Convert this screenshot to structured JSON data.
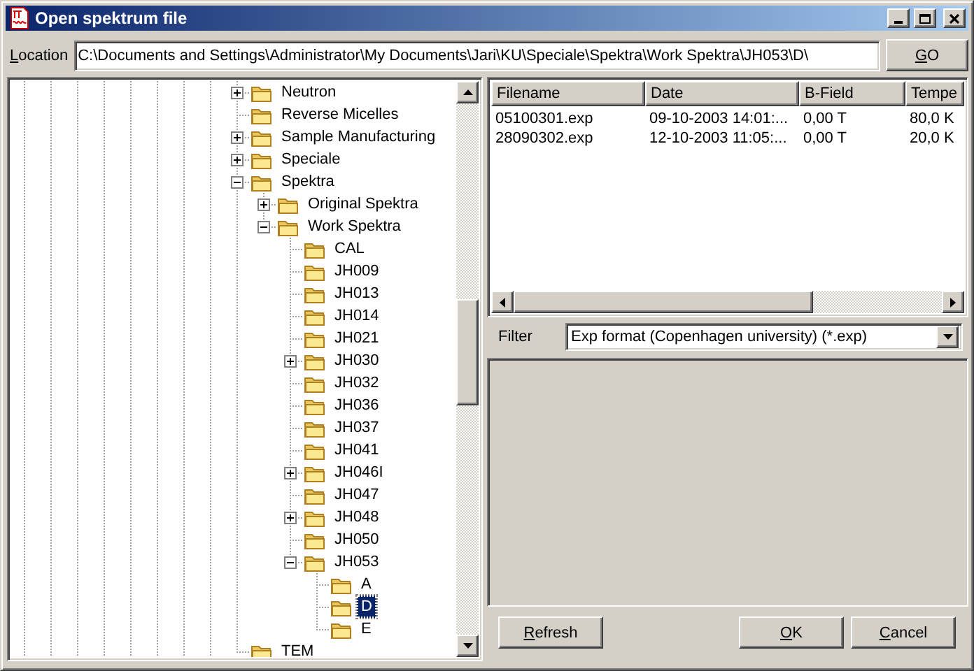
{
  "window": {
    "title": "Open spektrum file"
  },
  "location": {
    "label": "Location",
    "value": "C:\\Documents and Settings\\Administrator\\My Documents\\Jari\\KU\\Speciale\\Spektra\\Work Spektra\\JH053\\D\\"
  },
  "go_button": "GO",
  "tree": [
    {
      "label": "Neutron",
      "expanded": false,
      "selected": false
    },
    {
      "label": "Reverse Micelles",
      "selected": false
    },
    {
      "label": "Sample Manufacturing",
      "expanded": false,
      "selected": false
    },
    {
      "label": "Speciale",
      "expanded": false,
      "selected": false
    },
    {
      "label": "Spektra",
      "expanded": true,
      "selected": false,
      "children": [
        {
          "label": "Original Spektra",
          "expanded": false,
          "selected": false
        },
        {
          "label": "Work Spektra",
          "expanded": true,
          "selected": false,
          "children": [
            {
              "label": "CAL",
              "selected": false
            },
            {
              "label": "JH009",
              "selected": false
            },
            {
              "label": "JH013",
              "selected": false
            },
            {
              "label": "JH014",
              "selected": false
            },
            {
              "label": "JH021",
              "selected": false
            },
            {
              "label": "JH030",
              "expanded": false,
              "selected": false
            },
            {
              "label": "JH032",
              "selected": false
            },
            {
              "label": "JH036",
              "selected": false
            },
            {
              "label": "JH037",
              "selected": false
            },
            {
              "label": "JH041",
              "selected": false
            },
            {
              "label": "JH046I",
              "expanded": false,
              "selected": false
            },
            {
              "label": "JH047",
              "selected": false
            },
            {
              "label": "JH048",
              "expanded": false,
              "selected": false
            },
            {
              "label": "JH050",
              "selected": false
            },
            {
              "label": "JH053",
              "expanded": true,
              "selected": false,
              "children": [
                {
                  "label": "A",
                  "selected": false
                },
                {
                  "label": "D",
                  "selected": true
                },
                {
                  "label": "E",
                  "selected": false
                }
              ]
            }
          ]
        }
      ]
    },
    {
      "label": "TEM",
      "selected": false
    }
  ],
  "file_list": {
    "columns": [
      "Filename",
      "Date",
      "B-Field",
      "Tempe"
    ],
    "rows": [
      {
        "cells": [
          "05100301.exp",
          "09-10-2003 14:01:...",
          "0,00 T",
          "80,0 K"
        ],
        "selected": false
      },
      {
        "cells": [
          "28090302.exp",
          "12-10-2003 11:05:...",
          "0,00 T",
          "20,0 K"
        ],
        "selected": false
      }
    ]
  },
  "filter": {
    "label": "Filter",
    "value": "Exp format (Copenhagen university) (*.exp)"
  },
  "buttons": [
    "Refresh",
    "OK",
    "Cancel"
  ]
}
